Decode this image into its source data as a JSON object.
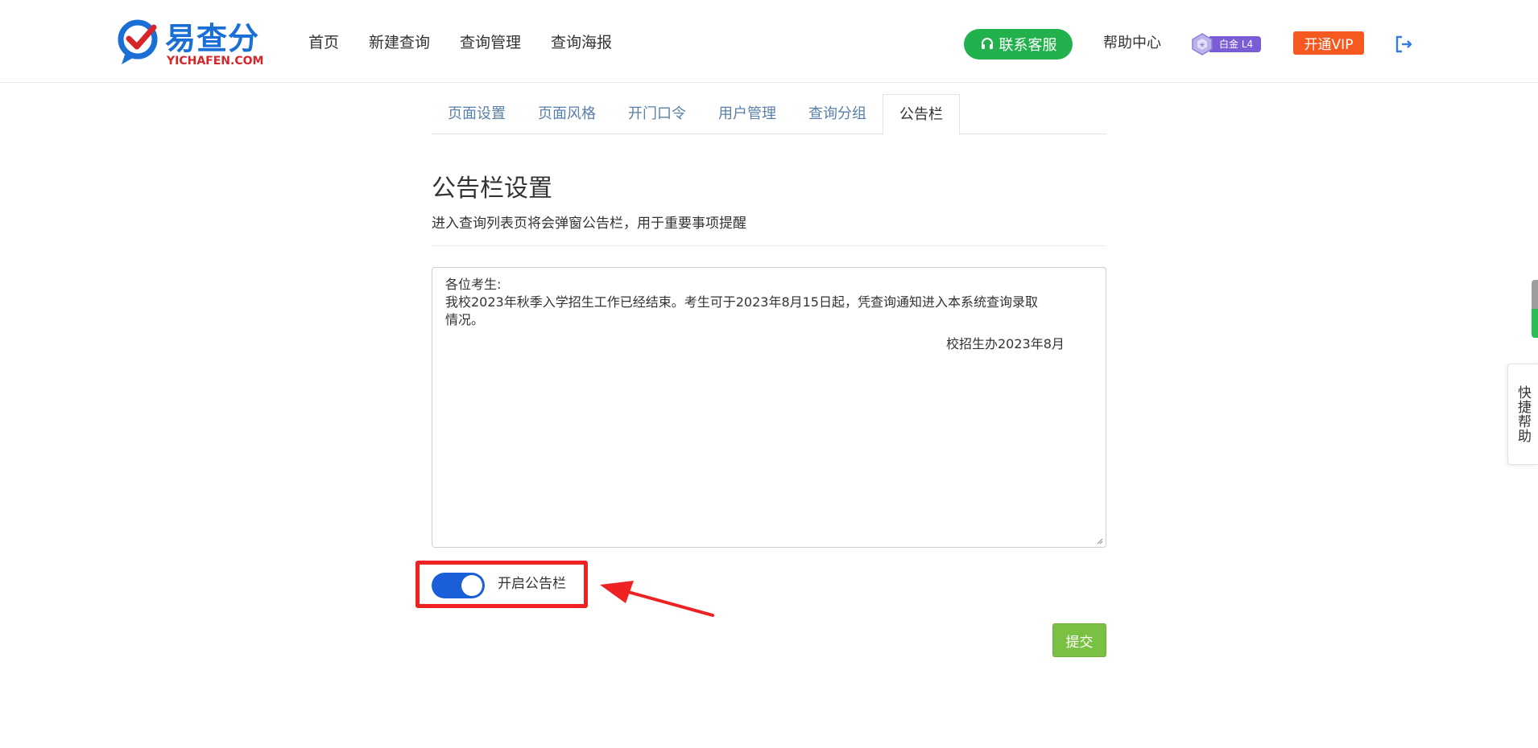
{
  "header": {
    "logo": {
      "cn": "易查分",
      "en": "YICHAFEN.COM"
    },
    "nav": [
      "首页",
      "新建查询",
      "查询管理",
      "查询海报"
    ],
    "service_button": "联系客服",
    "help_center": "帮助中心",
    "level_badge": "白金 L4",
    "vip_button": "开通VIP"
  },
  "tabs": [
    {
      "label": "页面设置",
      "active": false
    },
    {
      "label": "页面风格",
      "active": false
    },
    {
      "label": "开门口令",
      "active": false
    },
    {
      "label": "用户管理",
      "active": false
    },
    {
      "label": "查询分组",
      "active": false
    },
    {
      "label": "公告栏",
      "active": true
    }
  ],
  "section": {
    "title": "公告栏设置",
    "description": "进入查询列表页将会弹窗公告栏，用于重要事项提醒"
  },
  "notice": {
    "lines": [
      "各位考生:",
      "我校2023年秋季入学招生工作已经结束。考生可于2023年8月15日起，凭查询通知进入本系统查询录取",
      "情况。"
    ],
    "signature": "校招生办2023年8月"
  },
  "toggle": {
    "label": "开启公告栏",
    "on": true
  },
  "submit_label": "提交",
  "quick_help": "快捷帮助",
  "colors": {
    "brand_blue": "#1a6fd6",
    "service_green": "#22b14c",
    "vip_orange": "#f5591f",
    "toggle_blue": "#1a5fd8",
    "submit_green": "#7ac143",
    "highlight_red": "#ee2222"
  }
}
